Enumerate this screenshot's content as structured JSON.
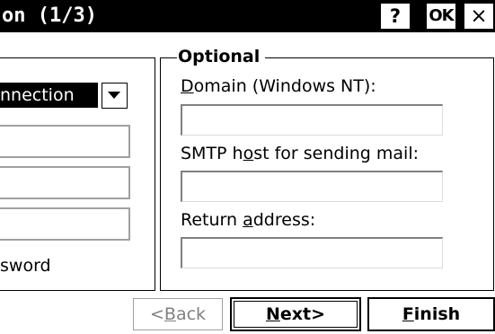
{
  "window": {
    "title": "on (1/3)",
    "help_button": "?",
    "ok_button": "OK",
    "close_button": "×"
  },
  "left_group": {
    "connection_value": "nnection",
    "password_label": "sword"
  },
  "optional_group": {
    "title": "Optional",
    "domain_label": {
      "before": "",
      "mnemonic": "D",
      "after": "omain (Windows NT):"
    },
    "domain_value": "",
    "smtp_label": {
      "before": "SMTP h",
      "mnemonic": "o",
      "after": "st for sending mail:"
    },
    "smtp_value": "",
    "return_label": {
      "before": "Return ",
      "mnemonic": "a",
      "after": "ddress:"
    },
    "return_value": ""
  },
  "buttons": {
    "back": {
      "before": "<",
      "mnemonic": "B",
      "after": "ack"
    },
    "next": {
      "before": "",
      "mnemonic": "N",
      "after": "ext>"
    },
    "finish": {
      "before": "",
      "mnemonic": "F",
      "after": "inish"
    }
  }
}
